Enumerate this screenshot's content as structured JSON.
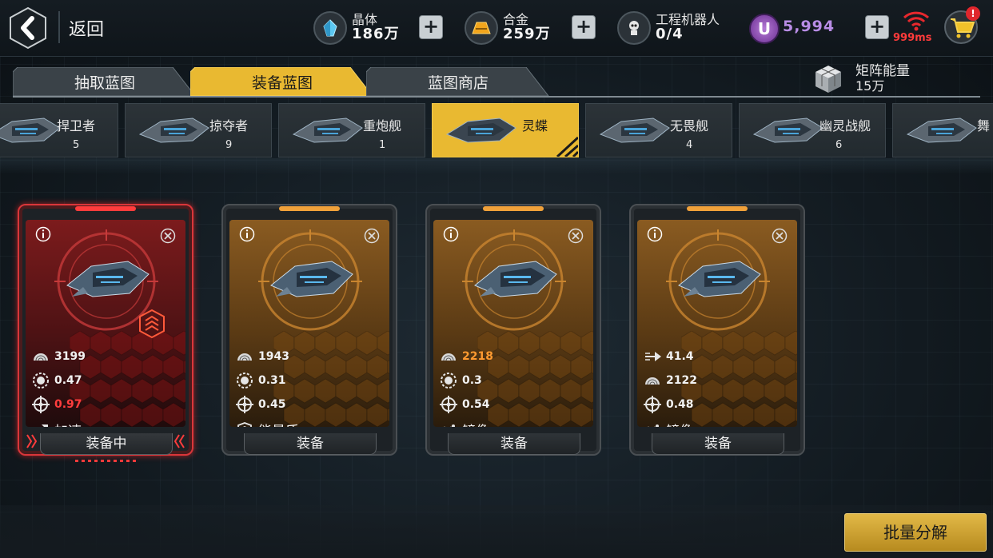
{
  "header": {
    "back_label": "返回",
    "resources": [
      {
        "name": "晶体",
        "value": "186万",
        "icon": "crystal-icon"
      },
      {
        "name": "合金",
        "value": "259万",
        "icon": "alloy-icon"
      },
      {
        "name": "工程机器人",
        "value": "0/4",
        "icon": "robot-icon"
      }
    ],
    "premium_currency": {
      "symbol": "U",
      "value": "5,994"
    },
    "ping": "999ms",
    "cart_badge": "!"
  },
  "tabs": [
    {
      "label": "抽取蓝图",
      "active": false
    },
    {
      "label": "装备蓝图",
      "active": true
    },
    {
      "label": "蓝图商店",
      "active": false
    }
  ],
  "matrix_energy": {
    "label": "矩阵能量",
    "value": "15万"
  },
  "ship_types": [
    {
      "name": "捍卫者",
      "count": "5"
    },
    {
      "name": "掠夺者",
      "count": "9"
    },
    {
      "name": "重炮舰",
      "count": "1"
    },
    {
      "name": "灵蝶",
      "count": "",
      "active": true
    },
    {
      "name": "无畏舰",
      "count": "4"
    },
    {
      "name": "幽灵战舰",
      "count": "6"
    },
    {
      "name": "舞",
      "count": ""
    }
  ],
  "cards": [
    {
      "state": "equipped",
      "stats": [
        {
          "icon": "armor-icon",
          "value": "3199",
          "color": "normal"
        },
        {
          "icon": "shield-gear-icon",
          "value": "0.47",
          "color": "normal"
        },
        {
          "icon": "crosshair-icon",
          "value": "0.97",
          "color": "red"
        }
      ],
      "skill": {
        "icon": "boost-icon",
        "label": "加速"
      },
      "button": "装备中"
    },
    {
      "state": "normal",
      "stats": [
        {
          "icon": "armor-icon",
          "value": "1943",
          "color": "normal"
        },
        {
          "icon": "shield-gear-icon",
          "value": "0.31",
          "color": "normal"
        },
        {
          "icon": "crosshair-icon",
          "value": "0.45",
          "color": "normal"
        }
      ],
      "skill": {
        "icon": "energy-shield-icon",
        "label": "能量盾"
      },
      "button": "装备"
    },
    {
      "state": "normal",
      "stats": [
        {
          "icon": "armor-icon",
          "value": "2218",
          "color": "orange"
        },
        {
          "icon": "shield-gear-icon",
          "value": "0.3",
          "color": "normal"
        },
        {
          "icon": "crosshair-icon",
          "value": "0.54",
          "color": "normal"
        }
      ],
      "skill": {
        "icon": "mirror-icon",
        "label": "镜像"
      },
      "button": "装备"
    },
    {
      "state": "normal",
      "stats": [
        {
          "icon": "speed-arrow-icon",
          "value": "41.4",
          "color": "normal"
        },
        {
          "icon": "armor-icon",
          "value": "2122",
          "color": "normal"
        },
        {
          "icon": "crosshair-icon",
          "value": "0.48",
          "color": "normal"
        }
      ],
      "skill": {
        "icon": "mirror-icon",
        "label": "镜像"
      },
      "button": "装备"
    }
  ],
  "bulk_button": "批量分解",
  "colors": {
    "accent": "#e9b931",
    "equipped": "#d9363a",
    "ping": "#ff3b3b",
    "premium": "#b98de6"
  }
}
